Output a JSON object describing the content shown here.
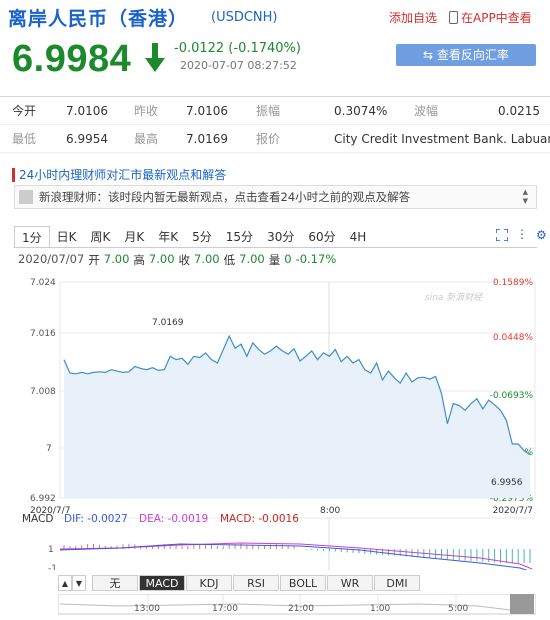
{
  "header": {
    "title": "离岸人民币（香港）",
    "code": "(USDCNH)",
    "add_favorite": "添加自选",
    "app_view": "在APP中查看",
    "price": "6.9984",
    "change": "-0.0122 (-0.1740%)",
    "time": "2020-07-07 08:27:52",
    "reverse_button": "查看反向汇率",
    "price_color": "#1b8a2a",
    "accent_color": "#1a63c8"
  },
  "stats": {
    "row1": [
      {
        "label": "今开",
        "value": "7.0106"
      },
      {
        "label": "昨收",
        "value": "7.0106"
      },
      {
        "label": "振幅",
        "value": "0.3074%"
      },
      {
        "label": "波幅",
        "value": "0.0215"
      }
    ],
    "row2": [
      {
        "label": "最低",
        "value": "6.9954"
      },
      {
        "label": "最高",
        "value": "7.0169"
      },
      {
        "label": "报价",
        "value": "City Credit Investment Bank. Labuan"
      }
    ]
  },
  "news": {
    "heading": "24小时内理财师对汇市最新观点和解答",
    "item": "新浪理财师：该时段内暂无最新观点，点击查看24小时之前的观点及解答"
  },
  "tabs": [
    "1分",
    "日K",
    "周K",
    "月K",
    "年K",
    "5分",
    "15分",
    "30分",
    "60分",
    "4H"
  ],
  "info": {
    "date": "2020/07/07",
    "open_label": "开",
    "open": "7.00",
    "high_label": "高",
    "high": "7.00",
    "close_label": "收",
    "close": "7.00",
    "low_label": "低",
    "low": "7.00",
    "vol_label": "量",
    "vol": "0",
    "pct": "-0.17%"
  },
  "chart_data": {
    "type": "line",
    "y_ticks_left": [
      "7.024",
      "7.016",
      "7.008",
      "7",
      "6.992"
    ],
    "y_ticks_right": [
      "0.1589%",
      "0.0448%",
      "-0.0693%",
      "-0.1834%",
      "-0.2975%"
    ],
    "ylim": [
      6.992,
      7.024
    ],
    "x_labels": [
      "2020/7/7",
      "8:00",
      "2020/7/7"
    ],
    "annotations": {
      "high": "7.0169",
      "low": "6.9956"
    },
    "watermark": "sina 新浪财经",
    "values": [
      7.0125,
      7.0105,
      7.0104,
      7.0106,
      7.0104,
      7.0106,
      7.0107,
      7.0106,
      7.011,
      7.0108,
      7.0106,
      7.0107,
      7.0115,
      7.0112,
      7.011,
      7.0113,
      7.0109,
      7.011,
      7.013,
      7.0125,
      7.0127,
      7.0118,
      7.013,
      7.0128,
      7.0135,
      7.0125,
      7.012,
      7.014,
      7.016,
      7.0142,
      7.0148,
      7.013,
      7.015,
      7.014,
      7.0133,
      7.0138,
      7.0145,
      7.0138,
      7.0133,
      7.0141,
      7.0123,
      7.013,
      7.0138,
      7.0125,
      7.0135,
      7.013,
      7.014,
      7.0122,
      7.013,
      7.012,
      7.0125,
      7.011,
      7.0105,
      7.012,
      7.0095,
      7.0108,
      7.0098,
      7.009,
      7.0105,
      7.0092,
      7.0098,
      7.0099,
      7.0096,
      7.01,
      7.0075,
      7.003,
      7.006,
      7.0057,
      7.005,
      7.006,
      7.0067,
      7.0052,
      7.0065,
      7.0058,
      7.005,
      7.0035,
      7.0,
      7.0,
      6.999,
      6.9984
    ],
    "line_color": "#3b8fc9",
    "fill_color": "#e8f1fa",
    "macd": {
      "label": "MACD",
      "dif_label": "DIF: -0.0027",
      "dea_label": "DEA: -0.0019",
      "macd_label": "MACD: -0.0016",
      "y_ticks": [
        "1",
        "-1"
      ]
    }
  },
  "indicators": [
    "无",
    "MACD",
    "KDJ",
    "RSI",
    "BOLL",
    "WR",
    "DMI"
  ],
  "timeline": [
    "13:00",
    "17:00",
    "21:00",
    "1:00",
    "5:00"
  ]
}
